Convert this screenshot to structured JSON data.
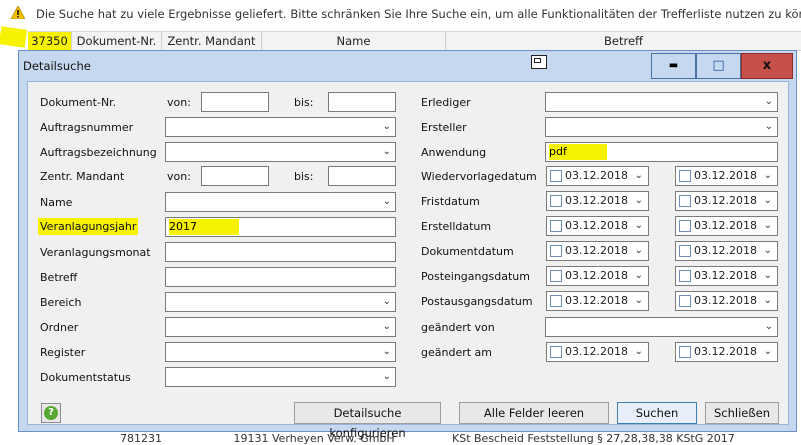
{
  "warning": {
    "text": "Die Suche hat zu viele Ergebnisse geliefert. Bitte schränken Sie Ihre Suche ein, um alle Funktionalitäten der Trefferliste nutzen zu können."
  },
  "grid": {
    "count": "37350",
    "columns": [
      "Dokument-Nr.",
      "Zentr. Mandant",
      "Name",
      "Betreff"
    ],
    "bottom_row": [
      "781231",
      "19131 Verheyen Verw. GmbH",
      "KSt Bescheid Feststellung § 27,28,38,38 KStG 2017"
    ]
  },
  "dialog": {
    "title": "Detailsuche",
    "controls": {
      "minimize": "▬",
      "maximize": "□",
      "close": "x"
    },
    "left": {
      "dokument_nr": "Dokument-Nr.",
      "von": "von:",
      "bis": "bis:",
      "auftragsnummer": "Auftragsnummer",
      "auftragsbezeichnung": "Auftragsbezeichnung",
      "zentr_mandant": "Zentr. Mandant",
      "name": "Name",
      "veranlagungsjahr": "Veranlagungsjahr",
      "veranlagungsjahr_value": "2017",
      "veranlagungsmonat": "Veranlagungsmonat",
      "betreff": "Betreff",
      "bereich": "Bereich",
      "ordner": "Ordner",
      "register": "Register",
      "dokumentstatus": "Dokumentstatus"
    },
    "right": {
      "erlediger": "Erlediger",
      "ersteller": "Ersteller",
      "anwendung": "Anwendung",
      "anwendung_value": "pdf",
      "wiedervorlagedatum": "Wiedervorlagedatum",
      "fristdatum": "Fristdatum",
      "erstelldatum": "Erstelldatum",
      "dokumentdatum": "Dokumentdatum",
      "posteingangsdatum": "Posteingangsdatum",
      "postausgangsdatum": "Postausgangsdatum",
      "geaendert_von": "geändert von",
      "geaendert_am": "geändert am",
      "date_value": "03.12.2018"
    },
    "buttons": {
      "configure": "Detailsuche konfigurieren",
      "clear": "Alle Felder leeren",
      "search": "Suchen",
      "close": "Schließen"
    },
    "help_icon": "help-icon"
  }
}
